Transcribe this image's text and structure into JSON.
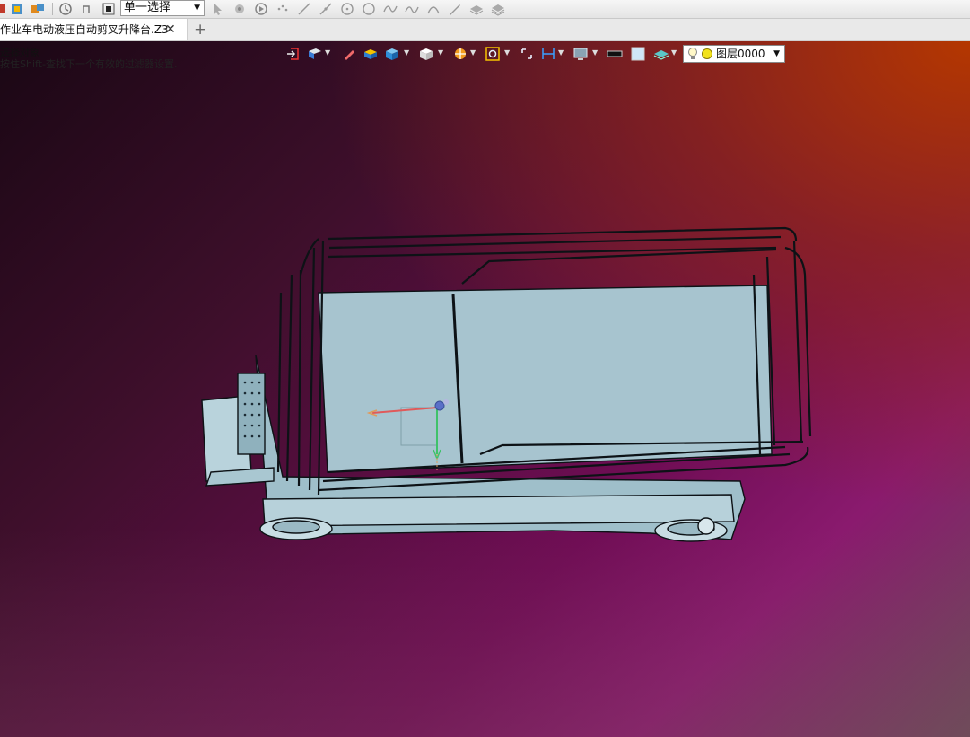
{
  "toolbar": {
    "filter_value": "单一选择",
    "icons": [
      "app-menu-icon",
      "part-icon",
      "assembly-icon",
      "history-icon",
      "undo-history-icon",
      "stop-icon",
      "pick-arrow-icon",
      "pick-multi-icon",
      "play-icon",
      "point-icon",
      "line-icon",
      "line-tangent-icon",
      "circle-center-icon",
      "circle-icon",
      "spline-icon",
      "curve-icon",
      "arc-icon",
      "pen-icon",
      "layer-stack-icon",
      "layer-stack2-icon"
    ]
  },
  "tab": {
    "title": "作业车电动液压自动剪叉升降台.Z3",
    "close": "✕",
    "new": "+"
  },
  "hint": {
    "line1": "选择对象",
    "line2": "按住Shift-查找下一个有效的过滤器设置."
  },
  "view_toolbar": {
    "layer": "图层0000"
  },
  "colors": {
    "model_fill": "#a9c8d3",
    "model_edge": "#101418"
  }
}
